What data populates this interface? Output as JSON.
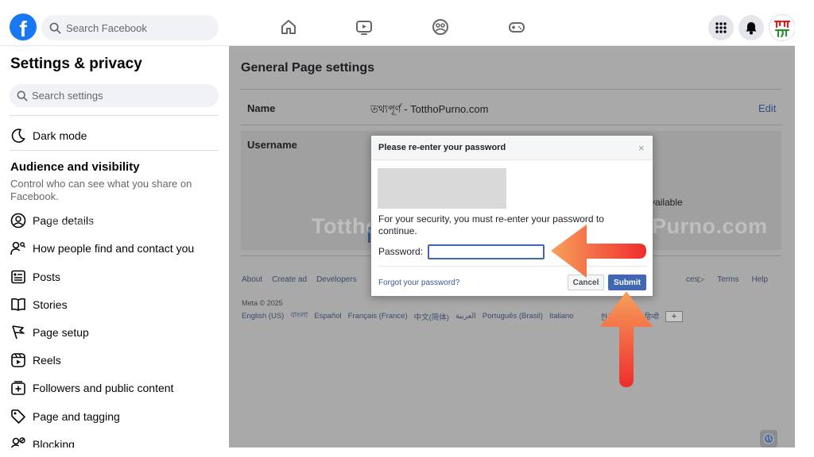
{
  "header": {
    "logo_letter": "f",
    "search_placeholder": "Search Facebook",
    "avatar_text": "তথ্য\nপূর্ণ"
  },
  "sidebar": {
    "title": "Settings & privacy",
    "search_placeholder": "Search settings",
    "dark_mode": "Dark mode",
    "section_heading": "Audience and visibility",
    "section_sub": "Control who can see what you share on Facebook.",
    "items": [
      {
        "label": "Page details",
        "icon": "person-circle-icon"
      },
      {
        "label": "How people find and contact you",
        "icon": "people-search-icon"
      },
      {
        "label": "Posts",
        "icon": "posts-icon"
      },
      {
        "label": "Stories",
        "icon": "book-icon"
      },
      {
        "label": "Page setup",
        "icon": "flag-icon"
      },
      {
        "label": "Reels",
        "icon": "reels-icon"
      },
      {
        "label": "Followers and public content",
        "icon": "plus-box-icon"
      },
      {
        "label": "Page and tagging",
        "icon": "tag-icon"
      },
      {
        "label": "Blocking",
        "icon": "person-block-icon"
      }
    ]
  },
  "main": {
    "title": "General Page settings",
    "name_label": "Name",
    "name_value": "তথ্যপূর্ণ - TotthoPurno.com",
    "edit_label": "Edit",
    "username_label": "Username",
    "available_text": "vailable",
    "footer_links": [
      "About",
      "Create ad",
      "Developers"
    ],
    "footer_right": [
      "ces▷",
      "Terms",
      "Help"
    ],
    "meta_text": "Meta © 2025",
    "languages": [
      "English (US)",
      "বাংলা",
      "Español",
      "Français (France)",
      "中文(简体)",
      "العربية",
      "Português (Brasil)",
      "Italiano",
      "한국",
      "हिन्दी"
    ],
    "plus_label": "+"
  },
  "watermark": [
    "TotthoPurno.com",
    "TotthoPurno.com",
    "TotthoPurno.com"
  ],
  "dialog": {
    "title": "Please re-enter your password",
    "close": "×",
    "message": "For your security, you must re-enter your password to continue.",
    "password_label": "Password:",
    "password_value": "",
    "forgot_link": "Forgot your password?",
    "cancel_label": "Cancel",
    "submit_label": "Submit"
  },
  "colors": {
    "facebook_blue": "#1877f2",
    "dialog_button_blue": "#4267b2",
    "arrow_orange": "#f5773a",
    "arrow_red": "#ef2d2d"
  }
}
